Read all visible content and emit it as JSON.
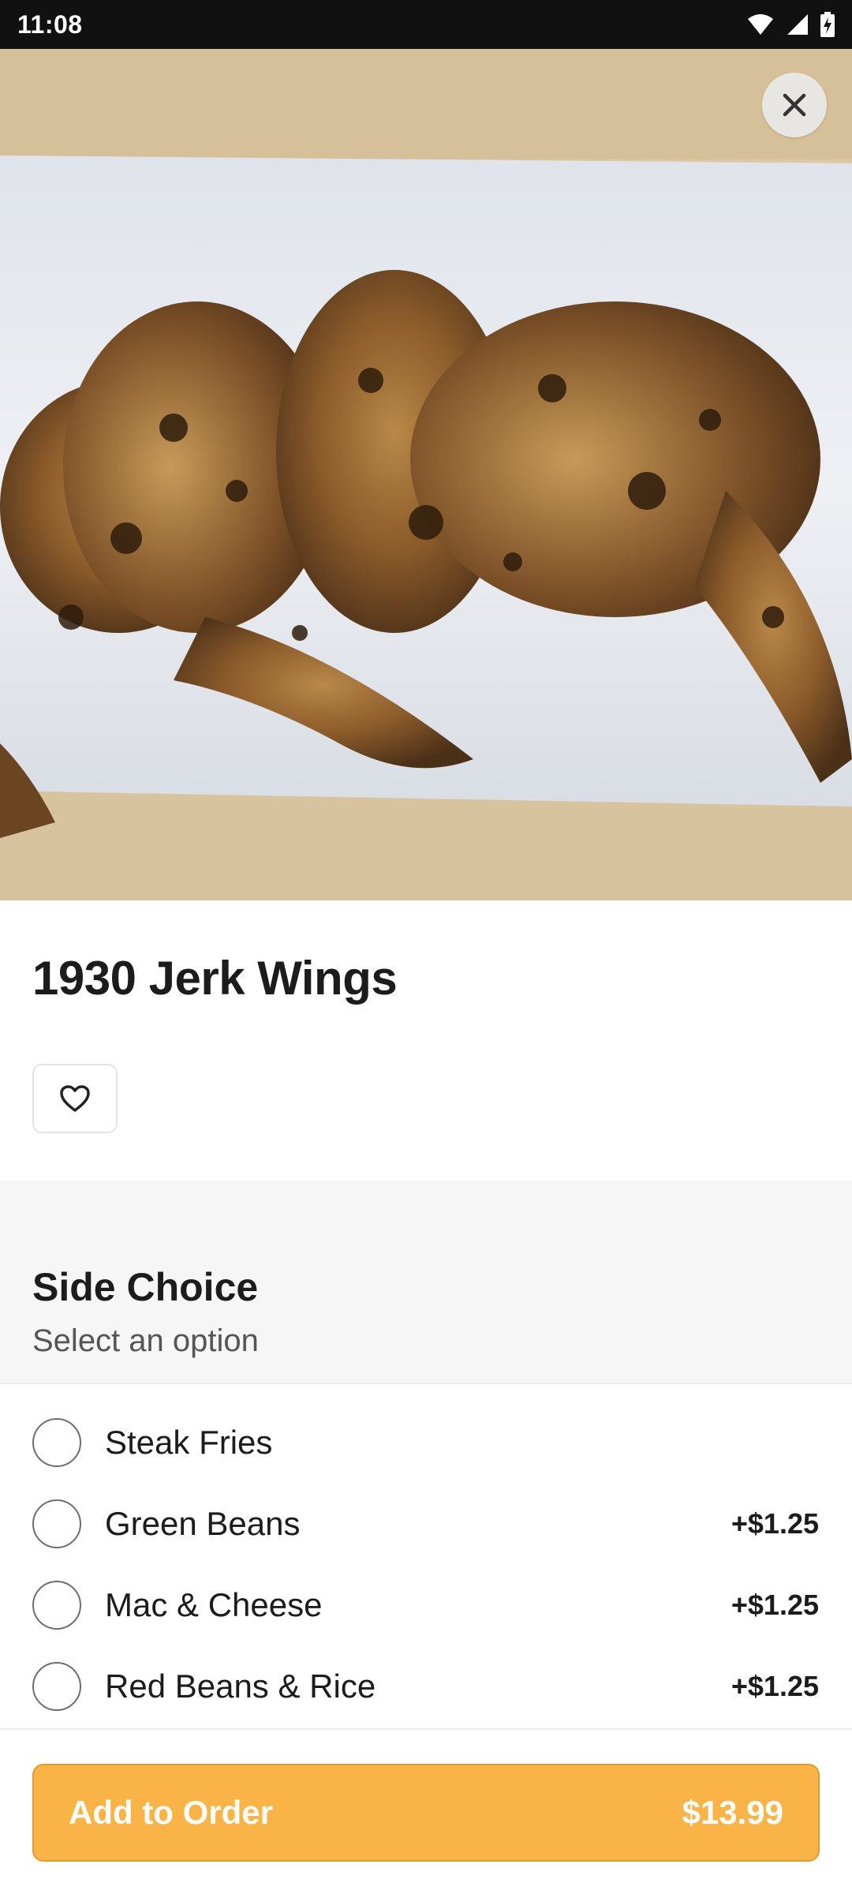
{
  "status_bar": {
    "time": "11:08",
    "icons": [
      "wifi-icon",
      "signal-icon",
      "battery-charging-icon"
    ]
  },
  "hero": {
    "image": "jerk-wings-photo",
    "close_icon": "close-icon"
  },
  "item": {
    "title": "1930 Jerk Wings",
    "favorite_icon": "heart-outline-icon"
  },
  "section": {
    "title": "Side Choice",
    "subtitle": "Select an option"
  },
  "options": [
    {
      "label": "Steak Fries",
      "price": ""
    },
    {
      "label": "Green Beans",
      "price": "+$1.25"
    },
    {
      "label": "Mac & Cheese",
      "price": "+$1.25"
    },
    {
      "label": "Red Beans & Rice",
      "price": "+$1.25"
    }
  ],
  "footer": {
    "add_label": "Add to Order",
    "total": "$13.99"
  },
  "colors": {
    "accent": "#f9b347",
    "accent_border": "#e39a2a",
    "status_bar": "#111111"
  }
}
